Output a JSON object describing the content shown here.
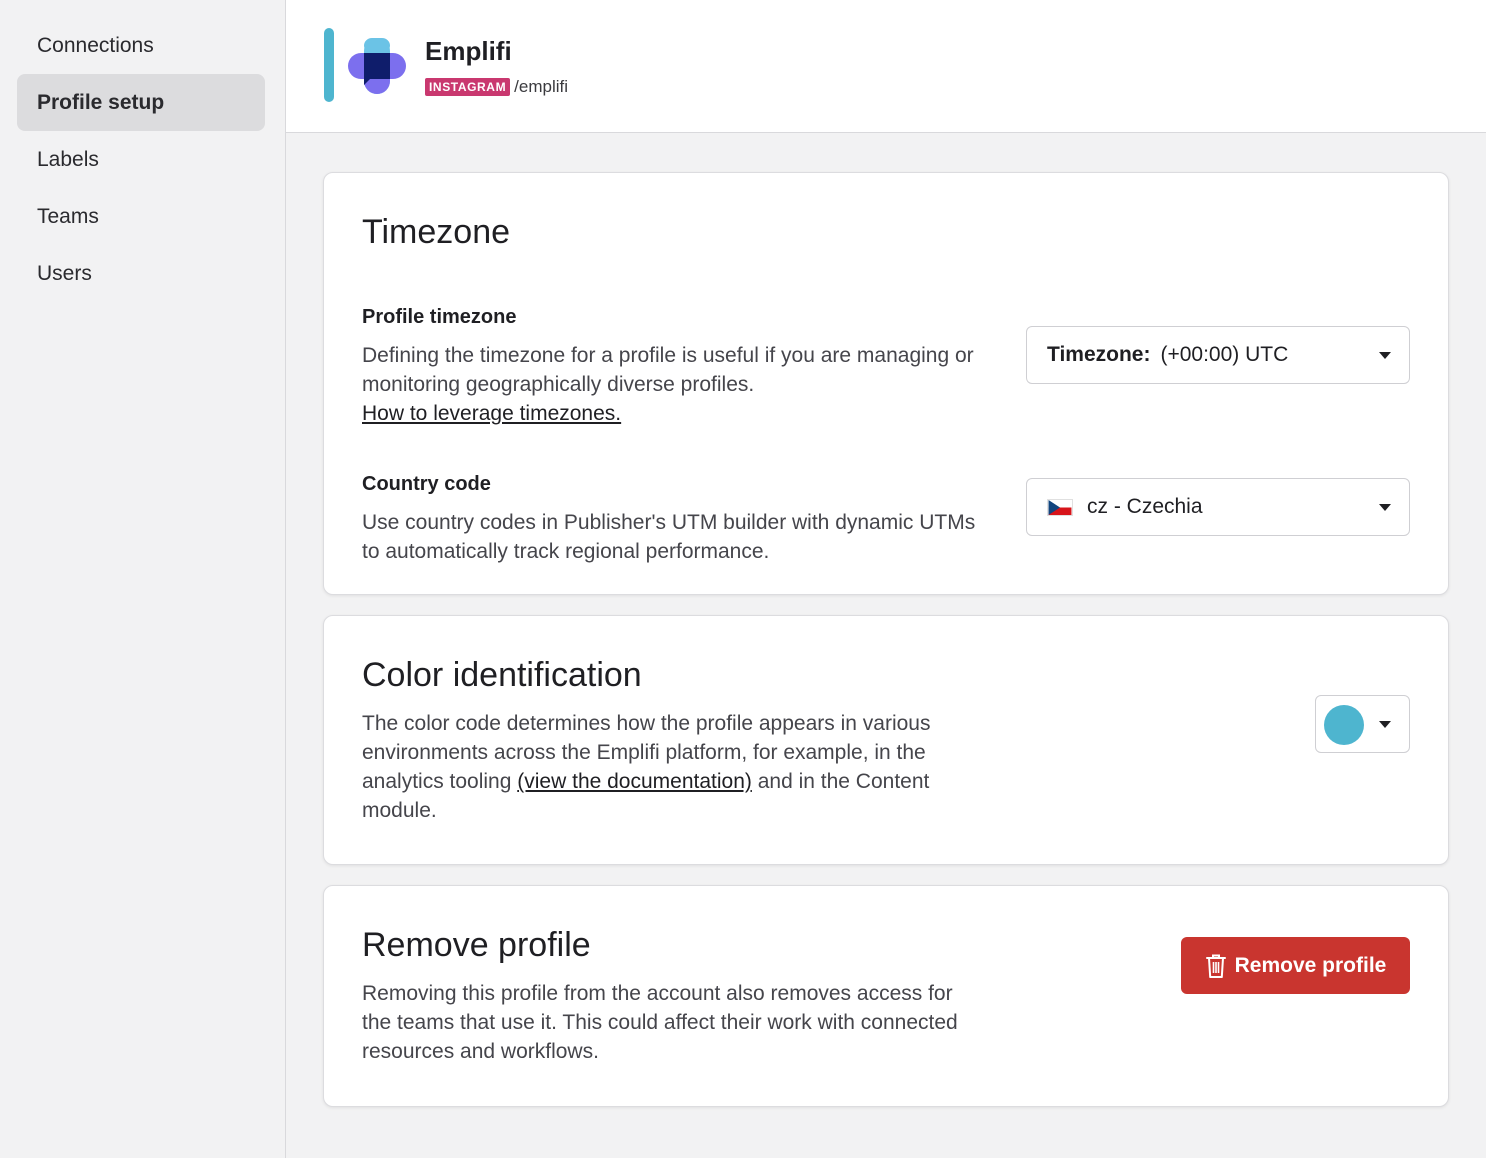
{
  "sidebar": {
    "items": [
      {
        "label": "Connections",
        "active": false
      },
      {
        "label": "Profile setup",
        "active": true
      },
      {
        "label": "Labels",
        "active": false
      },
      {
        "label": "Teams",
        "active": false
      },
      {
        "label": "Users",
        "active": false
      }
    ]
  },
  "header": {
    "profile_name": "Emplifi",
    "network": "INSTAGRAM",
    "handle": "/emplifi",
    "accent_color": "#4eb5cf",
    "network_badge_color": "#c9386f"
  },
  "timezone_card": {
    "title": "Timezone",
    "profile_timezone": {
      "label": "Profile timezone",
      "description": "Defining the timezone for a profile is useful if you are managing or monitoring geographically diverse profiles.",
      "link": "How to leverage timezones.",
      "select_label": "Timezone:",
      "select_value": "(+00:00) UTC"
    },
    "country_code": {
      "label": "Country code",
      "description": "Use country codes in Publisher's UTM builder with dynamic UTMs to automatically track regional performance.",
      "select_value": "cz - Czechia",
      "flag_icon": "czech-flag-icon"
    }
  },
  "color_card": {
    "title": "Color identification",
    "desc_before": "The color code determines how the profile appears in various environments across the Emplifi platform, for example, in the analytics tooling ",
    "desc_link": "(view the documentation)",
    "desc_after": " and in the Content module.",
    "selected_color": "#4eb5cf"
  },
  "remove_card": {
    "title": "Remove profile",
    "description": "Removing this profile from the account also removes access for the teams that use it. This could affect their work with connected resources and workflows.",
    "button_label": "Remove profile",
    "button_color": "#c9352f",
    "button_icon": "trash-icon"
  }
}
